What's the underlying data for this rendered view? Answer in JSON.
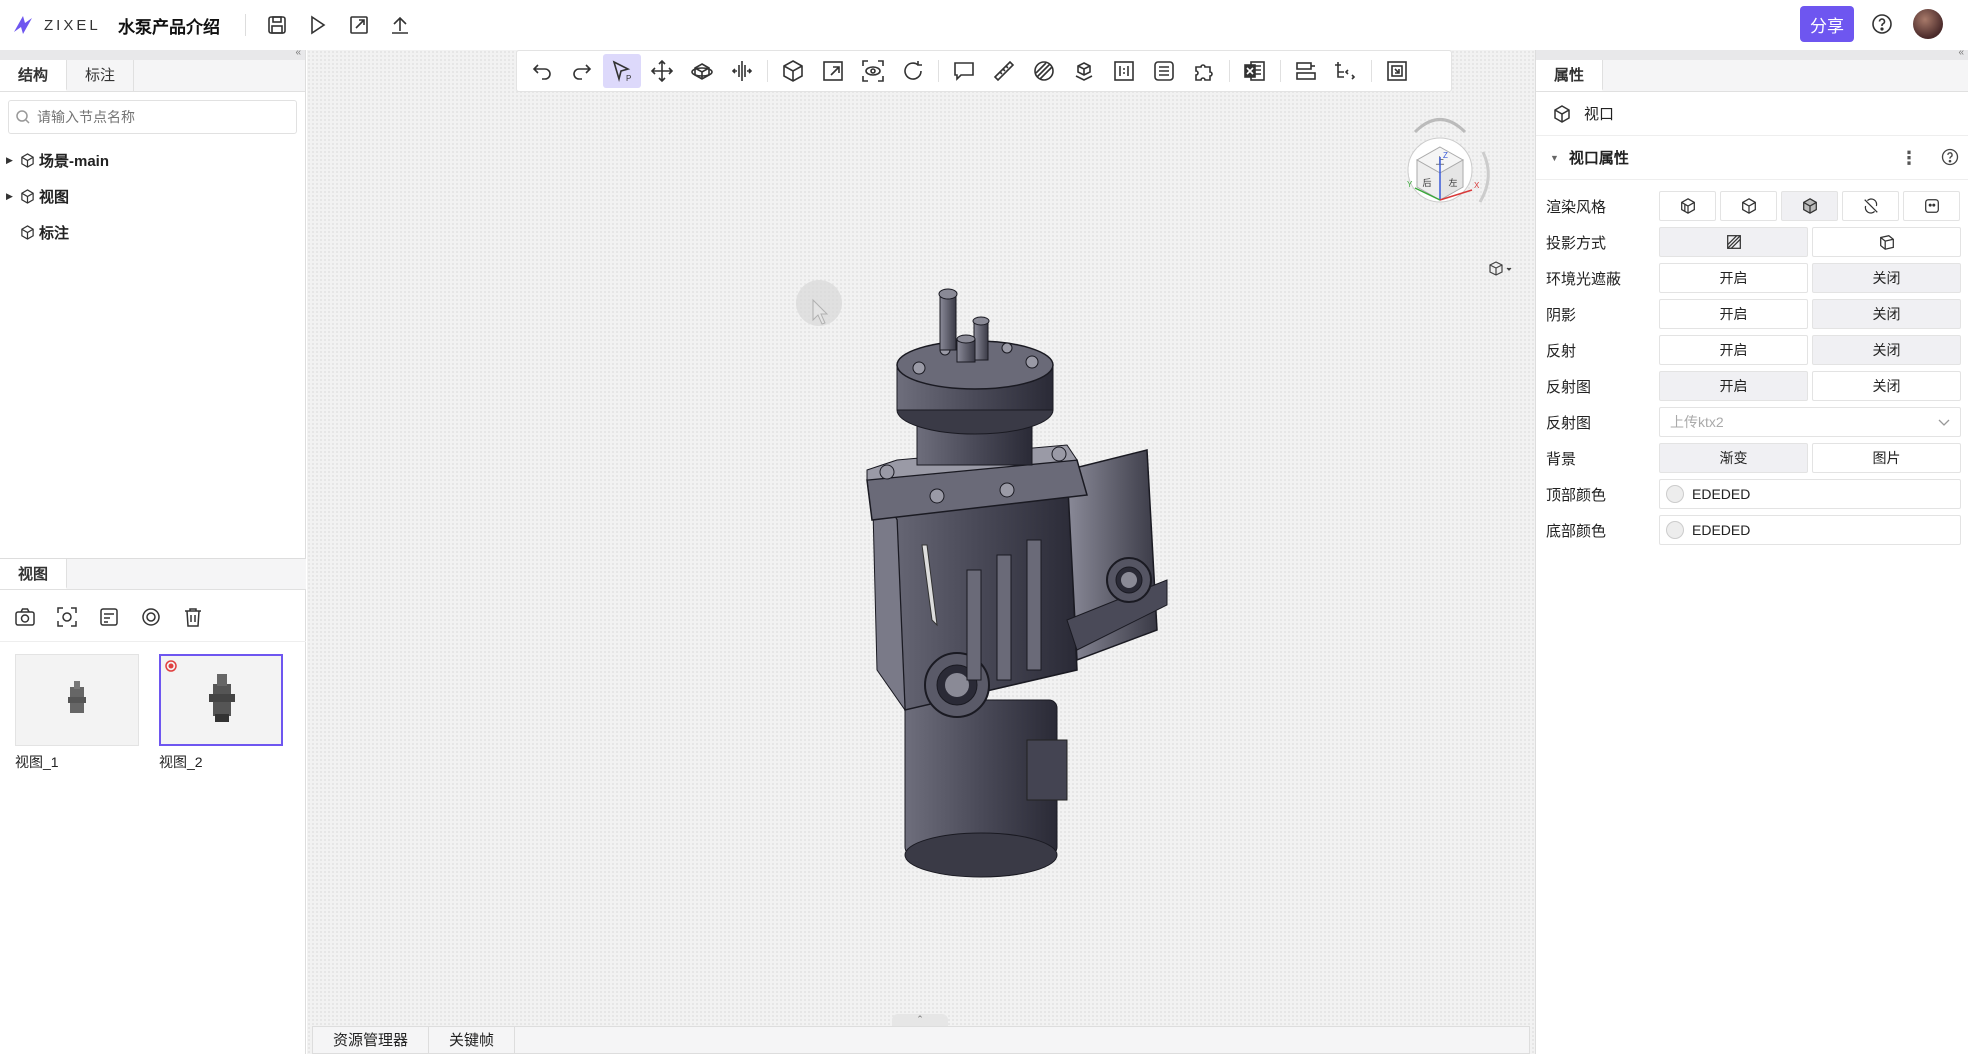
{
  "app": {
    "logo_text": "ZIXEL",
    "project_title": "水泵产品介绍",
    "share_label": "分享",
    "brand_color": "#6e56f0"
  },
  "left": {
    "tabs": [
      "结构",
      "标注"
    ],
    "search_placeholder": "请输入节点名称",
    "tree": [
      "场景-main",
      "视图",
      "标注"
    ],
    "views_tab": "视图",
    "thumbnails": [
      {
        "label": "视图_1"
      },
      {
        "label": "视图_2"
      }
    ]
  },
  "toolbar": {
    "icons": [
      "undo-icon",
      "redo-icon",
      "select-icon",
      "move-icon",
      "rotate-icon",
      "split-icon",
      "box-icon",
      "zoom-window-icon",
      "focus-icon",
      "refresh-icon",
      "comment-icon",
      "measure-icon",
      "section-icon",
      "explode-icon",
      "dimension-icon",
      "list-icon",
      "puzzle-icon",
      "excel-icon",
      "align-icon",
      "tree-icon",
      "copy-icon"
    ]
  },
  "nav_cube": {
    "faces": [
      "上",
      "后",
      "左"
    ],
    "axes": [
      "Z",
      "Y",
      "X"
    ]
  },
  "bottom_tabs": [
    "资源管理器",
    "关键帧"
  ],
  "right": {
    "tab": "属性",
    "object_label": "视口",
    "section_title": "视口属性",
    "rows": [
      {
        "label": "渲染风格",
        "type": "icons"
      },
      {
        "label": "投影方式",
        "type": "icons2"
      },
      {
        "label": "环境光遮蔽",
        "type": "toggle",
        "options": [
          "开启",
          "关闭"
        ],
        "selected": 1
      },
      {
        "label": "阴影",
        "type": "toggle",
        "options": [
          "开启",
          "关闭"
        ],
        "selected": 1
      },
      {
        "label": "反射",
        "type": "toggle",
        "options": [
          "开启",
          "关闭"
        ],
        "selected": 1
      },
      {
        "label": "反射图",
        "type": "toggle",
        "options": [
          "开启",
          "关闭"
        ],
        "selected": 0
      },
      {
        "label": "反射图",
        "type": "select",
        "placeholder": "上传ktx2"
      },
      {
        "label": "背景",
        "type": "toggle",
        "options": [
          "渐变",
          "图片"
        ],
        "selected": 0
      },
      {
        "label": "顶部颜色",
        "type": "color",
        "value": "EDEDED"
      },
      {
        "label": "底部颜色",
        "type": "color",
        "value": "EDEDED"
      }
    ]
  }
}
